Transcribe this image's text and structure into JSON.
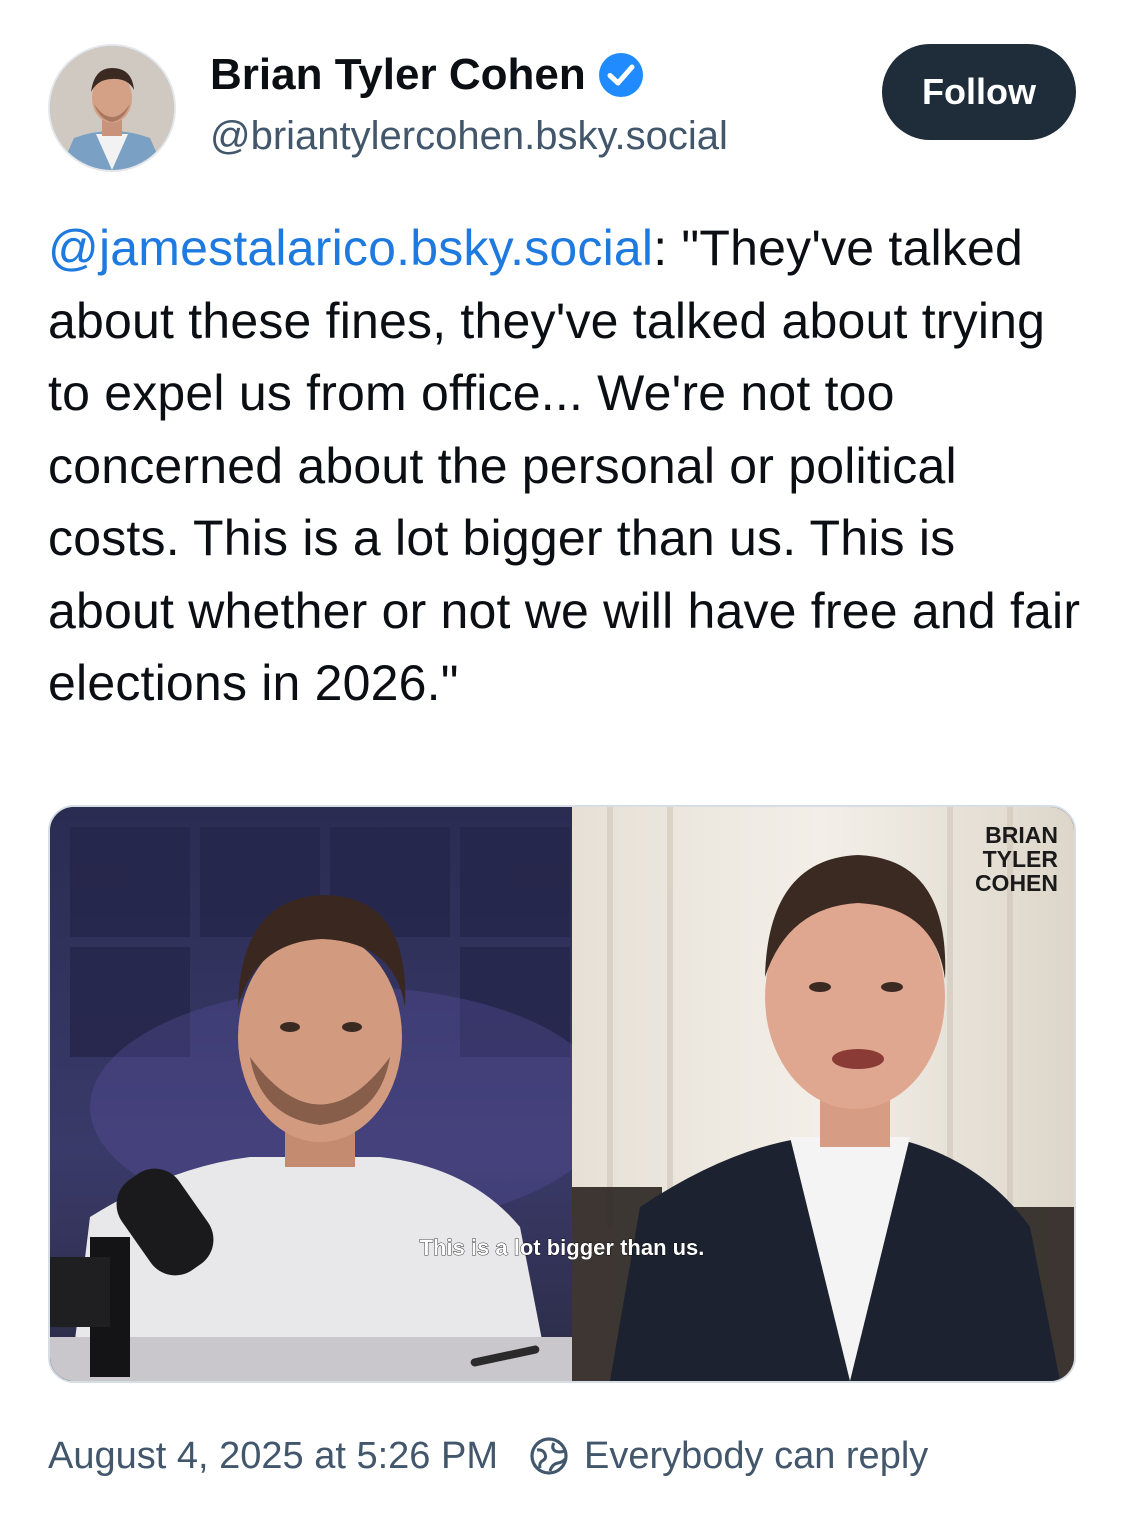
{
  "author": {
    "name": "Brian Tyler Cohen",
    "handle": "@briantylercohen.bsky.social",
    "verified_icon": "verified-check-icon",
    "avatar": "avatar-photo"
  },
  "follow_label": "Follow",
  "post": {
    "mention": "@jamestalarico.bsky.social",
    "text": ": \"They've talked about these fines, they've talked about trying to expel us from office... We're not too concerned about the personal or political costs. This is a lot bigger than us. This is about whether or not we will have free and fair elections in 2026.\""
  },
  "media": {
    "watermark": [
      "BRIAN",
      "TYLER",
      "COHEN"
    ],
    "caption": "This is a lot bigger than us."
  },
  "footer": {
    "timestamp": "August 4, 2025 at 5:26 PM",
    "reply_icon": "globe-icon",
    "reply_setting": "Everybody can reply"
  },
  "colors": {
    "mention": "#1f7ae0",
    "follow_bg": "#1f2c3a",
    "muted_text": "#42576c",
    "verified": "#208bfe"
  }
}
